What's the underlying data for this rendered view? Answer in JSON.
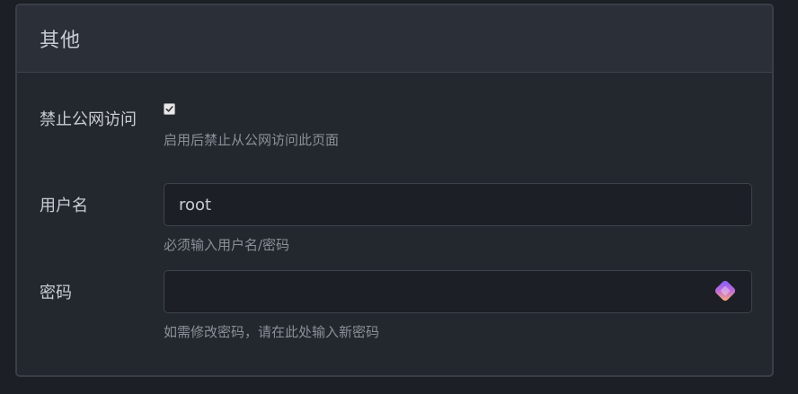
{
  "section": {
    "title": "其他"
  },
  "fields": {
    "disable_public": {
      "label": "禁止公网访问",
      "checked": true,
      "help": "启用后禁止从公网访问此页面"
    },
    "username": {
      "label": "用户名",
      "value": "root",
      "help": "必须输入用户名/密码"
    },
    "password": {
      "label": "密码",
      "value": "",
      "help": "如需修改密码，请在此处输入新密码",
      "icon": "password-manager-icon"
    }
  }
}
